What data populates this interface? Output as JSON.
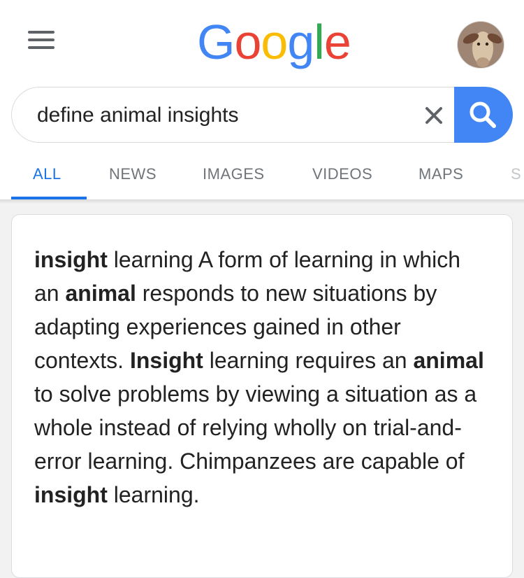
{
  "header": {
    "menu_icon": "hamburger-menu-icon",
    "logo": {
      "letters": [
        "G",
        "o",
        "o",
        "g",
        "l",
        "e"
      ],
      "colors": [
        "#4285f4",
        "#ea4335",
        "#fbbc05",
        "#4285f4",
        "#34a853",
        "#ea4335"
      ]
    },
    "avatar_icon": "goat-profile-avatar"
  },
  "search": {
    "query": "define animal insights",
    "clear_icon": "close-icon",
    "search_icon": "magnifier-icon",
    "accent": "#4285f4"
  },
  "tabs": [
    {
      "label": "ALL",
      "active": true
    },
    {
      "label": "NEWS",
      "active": false
    },
    {
      "label": "IMAGES",
      "active": false
    },
    {
      "label": "VIDEOS",
      "active": false
    },
    {
      "label": "MAPS",
      "active": false
    },
    {
      "label": "S",
      "active": false
    }
  ],
  "definition": {
    "segments": [
      {
        "text": "insight",
        "bold": true
      },
      {
        "text": " learning A form of learning in which an ",
        "bold": false
      },
      {
        "text": "animal",
        "bold": true
      },
      {
        "text": " responds to new situations by adapting experiences gained in other contexts. ",
        "bold": false
      },
      {
        "text": "Insight",
        "bold": true
      },
      {
        "text": " learning requires an ",
        "bold": false
      },
      {
        "text": "animal",
        "bold": true
      },
      {
        "text": " to solve problems by viewing a situation as a whole instead of relying wholly on trial-and-error learning. Chimpanzees are capable of ",
        "bold": false
      },
      {
        "text": "insight",
        "bold": true
      },
      {
        "text": " learning.",
        "bold": false
      }
    ]
  }
}
